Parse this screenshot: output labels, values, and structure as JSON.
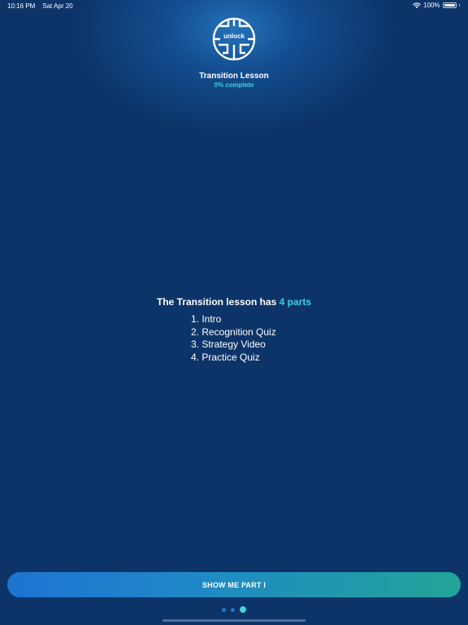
{
  "status_bar": {
    "time": "10:16 PM",
    "date": "Sat Apr 20",
    "battery": "100%",
    "battery_level": 1.0
  },
  "logo": {
    "text": "unlock"
  },
  "lesson": {
    "title": "Transition Lesson",
    "progress": "0% complete"
  },
  "summary": {
    "prefix": "The Transition lesson has ",
    "highlight": "4 parts"
  },
  "parts": [
    "1. Intro",
    "2. Recognition Quiz",
    "3. Strategy Video",
    "4. Practice Quiz"
  ],
  "cta": {
    "label": "SHOW ME PART I"
  },
  "pager": {
    "total": 3,
    "active_index": 2
  },
  "colors": {
    "background": "#0c3468",
    "accent": "#3fd0e0",
    "button_start": "#1e73d2",
    "button_end": "#22a497"
  }
}
